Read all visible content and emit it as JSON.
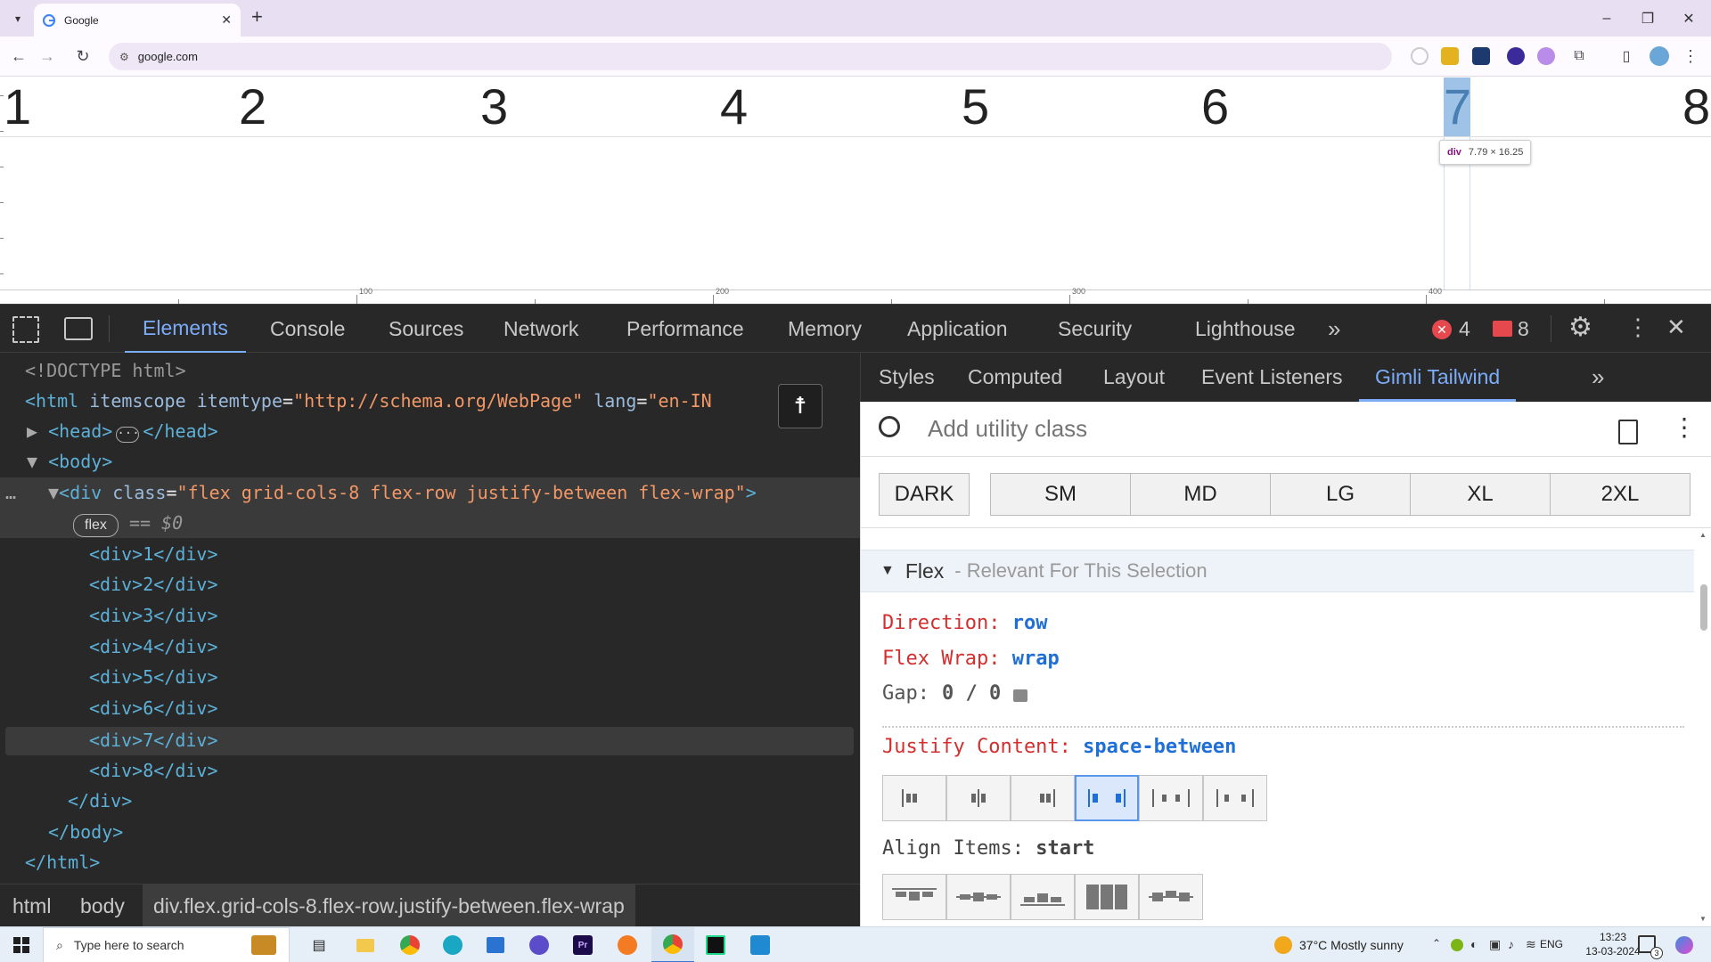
{
  "browser": {
    "tab_title": "Google",
    "new_tab": "+",
    "url": "google.com",
    "window_controls": [
      "minimize",
      "restore",
      "close"
    ]
  },
  "page": {
    "numbers": [
      "1",
      "2",
      "3",
      "4",
      "5",
      "6",
      "7",
      "8"
    ],
    "tooltip_tag": "div",
    "tooltip_size": "7.79 × 16.25",
    "ruler_labels": [
      "100",
      "200",
      "300",
      "400"
    ]
  },
  "devtools": {
    "tabs": [
      "Elements",
      "Console",
      "Sources",
      "Network",
      "Performance",
      "Memory",
      "Application",
      "Security",
      "Lighthouse"
    ],
    "active_tab": "Elements",
    "error_count": "4",
    "message_count": "8",
    "dom": {
      "doctype": "<!DOCTYPE html>",
      "html_open": "<html",
      "html_attr1": "itemscope",
      "html_attr2": "itemtype",
      "html_attr2_val": "\"http://schema.org/WebPage\"",
      "html_attr3": "lang",
      "html_attr3_val": "\"en-IN",
      "head": "<head>",
      "head_close": "</head>",
      "body": "<body>",
      "div_open": "<div",
      "div_class_attr": "class",
      "div_class_val": "\"flex grid-cols-8 flex-row justify-between flex-wrap\"",
      "flex_badge": "flex",
      "eq": "== $0",
      "children": [
        "<div>1</div>",
        "<div>2</div>",
        "<div>3</div>",
        "<div>4</div>",
        "<div>5</div>",
        "<div>6</div>",
        "<div>7</div>",
        "<div>8</div>"
      ],
      "div_close": "</div>",
      "body_close": "</body>",
      "html_close": "</html>"
    },
    "breadcrumbs": [
      "html",
      "body",
      "div.flex.grid-cols-8.flex-row.justify-between.flex-wrap"
    ],
    "sidebar_tabs": [
      "Styles",
      "Computed",
      "Layout",
      "Event Listeners",
      "Gimli Tailwind"
    ],
    "active_sidebar_tab": "Gimli Tailwind"
  },
  "gimli": {
    "search_placeholder": "Add utility class",
    "dark_label": "DARK",
    "breakpoints": [
      "SM",
      "MD",
      "LG",
      "XL",
      "2XL"
    ],
    "section_title": "Flex",
    "section_subtitle": "- Relevant For This Selection",
    "direction_label": "Direction:",
    "direction_value": "row",
    "wrap_label": "Flex Wrap:",
    "wrap_value": "wrap",
    "gap_label": "Gap:",
    "gap_value": "0 / 0",
    "justify_label": "Justify Content:",
    "justify_value": "space-between",
    "justify_options": [
      "start",
      "center",
      "end",
      "between",
      "around",
      "evenly"
    ],
    "justify_active_index": 3,
    "align_label": "Align Items:",
    "align_value": "start",
    "align_options": [
      "start",
      "center",
      "end",
      "stretch",
      "baseline"
    ]
  },
  "taskbar": {
    "search_placeholder": "Type here to search",
    "weather": "37°C  Mostly sunny",
    "lang": "ENG",
    "time": "13:23",
    "date": "13-03-2024",
    "notification_count": "3"
  }
}
